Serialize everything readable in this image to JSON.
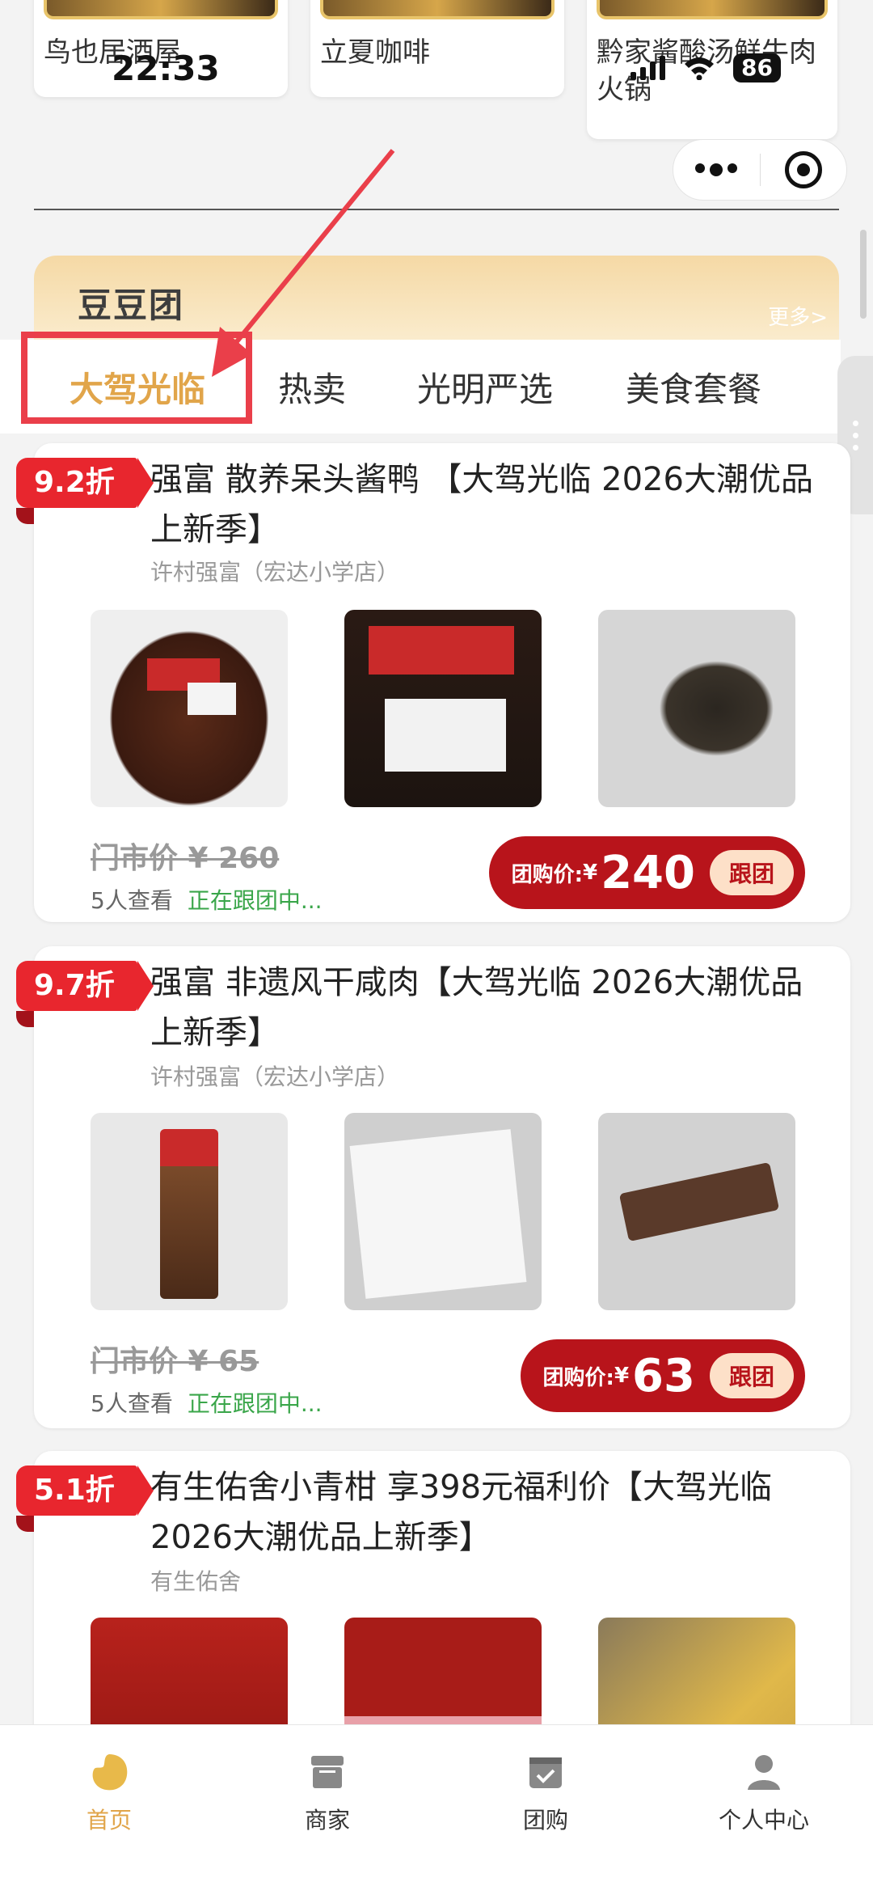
{
  "status_bar": {
    "time": "22:33",
    "battery": "86"
  },
  "shops": [
    {
      "name": "鸟也居酒屋"
    },
    {
      "name": "立夏咖啡"
    },
    {
      "name": "黔家酱酸汤鲜牛肉火锅"
    }
  ],
  "section": {
    "title": "豆豆团",
    "more": "更多>"
  },
  "tabs": [
    "大驾光临",
    "热卖",
    "光明严选",
    "美食套餐"
  ],
  "products": [
    {
      "discount": "9.2折",
      "title": "强富 散养呆头酱鸭 【大驾光临 2026大潮优品上新季】",
      "shop": "许村强富（宏达小学店）",
      "original_price": "门市价 ¥ 260",
      "views": "5人查看",
      "status": "正在跟团中...",
      "price_label": "团购价:",
      "price": "240",
      "join": "跟团"
    },
    {
      "discount": "9.7折",
      "title": "强富 非遗风干咸肉【大驾光临 2026大潮优品上新季】",
      "shop": "许村强富（宏达小学店）",
      "original_price": "门市价 ¥ 65",
      "views": "5人查看",
      "status": "正在跟团中...",
      "price_label": "团购价:",
      "price": "63",
      "join": "跟团"
    },
    {
      "discount": "5.1折",
      "title": "有生佑舍小青柑 享398元福利价【大驾光临 2026大潮优品上新季】",
      "shop": "有生佑舍"
    }
  ],
  "nav": [
    {
      "label": "首页",
      "icon": "home-icon"
    },
    {
      "label": "商家",
      "icon": "store-icon"
    },
    {
      "label": "团购",
      "icon": "group-buy-icon"
    },
    {
      "label": "个人中心",
      "icon": "profile-icon"
    }
  ],
  "colors": {
    "accent": "#e1a54a",
    "price_button": "#b8141b",
    "discount_tag": "#e8262e",
    "annotation": "#ea3f4a"
  }
}
